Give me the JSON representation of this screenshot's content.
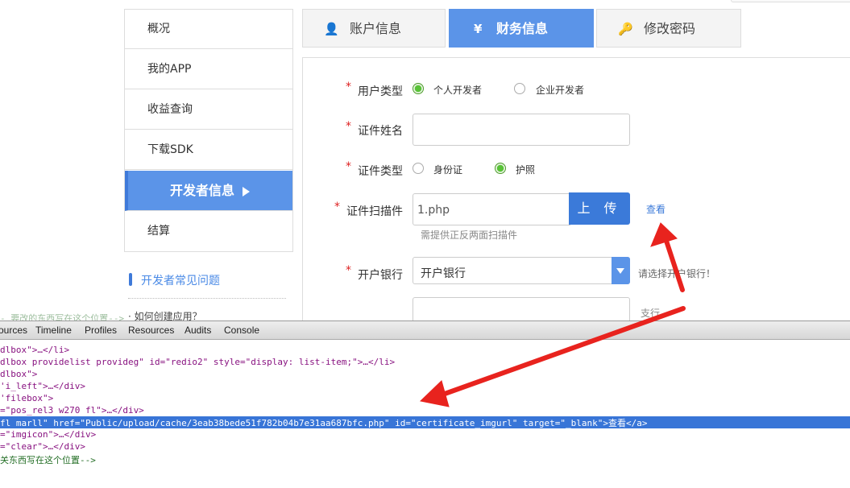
{
  "nav": {
    "items": [
      {
        "label": "概况"
      },
      {
        "label": "我的APP"
      },
      {
        "label": "收益查询"
      },
      {
        "label": "下载SDK"
      },
      {
        "label": "开发者信息"
      },
      {
        "label": "结算"
      }
    ],
    "active_index": 4
  },
  "faq": {
    "title": "开发者常见问题",
    "items": [
      "· 如何创建应用？"
    ]
  },
  "tabs": [
    {
      "label": "账户信息",
      "icon": "user-icon",
      "glyph": "👤"
    },
    {
      "label": "财务信息",
      "icon": "yen-icon",
      "glyph": "¥"
    },
    {
      "label": "修改密码",
      "icon": "key-icon",
      "glyph": "🔑"
    }
  ],
  "active_tab": 1,
  "form": {
    "required_mark": "*",
    "user_type": {
      "label": "用户类型",
      "options": [
        "个人开发者",
        "企业开发者"
      ],
      "selected": "个人开发者"
    },
    "cert_name": {
      "label": "证件姓名",
      "value": ""
    },
    "cert_type": {
      "label": "证件类型",
      "options": [
        "身份证",
        "护照"
      ],
      "selected": "护照"
    },
    "cert_scan": {
      "label": "证件扫描件",
      "value": "1.php",
      "upload_label": "上 传",
      "view_link": "查看",
      "hint": "需提供正反两面扫描件"
    },
    "bank": {
      "label": "开户银行",
      "selected": "开户银行",
      "hint": "请选择开户银行！"
    },
    "branch": {
      "suffix": "支行",
      "value": ""
    }
  },
  "devtools": {
    "tabs": [
      "ources",
      "Timeline",
      "Profiles",
      "Resources",
      "Audits",
      "Console"
    ],
    "lines": {
      "l0": "- 要改的东西写在这个位置-->",
      "l1": "dlbox\">…</li>",
      "l2": "dlbox providelist provideg\" id=\"redio2\" style=\"display: list-item;\">…</li>",
      "l3": "dlbox\">",
      "l4": "'i_left\">…</div>",
      "l5": "'filebox\">",
      "l6": "=\"pos_rel3 w270 fl\">…</div>",
      "l7": "fl marll\" href=\"Public/upload/cache/3eab38bede51f782b04b7e31aa687bfc.php\" id=\"certificate_imgurl\" target=\"_blank\">查看</a>",
      "l8": "=\"imgicon\">…</div>",
      "l9": "=\"clear\">…</div>",
      "l10": "关东西写在这个位置-->"
    }
  },
  "colors": {
    "accent": "#5b94e8",
    "annotation_arrow": "#e8231e",
    "required": "#dd2222"
  }
}
